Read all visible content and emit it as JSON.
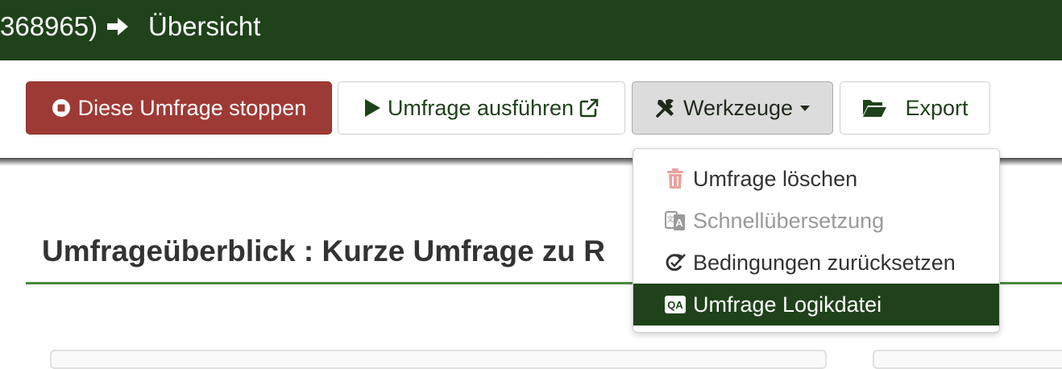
{
  "breadcrumb": {
    "previous": "368965)",
    "current": "Übersicht"
  },
  "toolbar": {
    "stop_label": "Diese Umfrage stoppen",
    "run_label": "Umfrage ausführen",
    "tools_label": "Werkzeuge",
    "export_label": "Export"
  },
  "tools_menu": {
    "items": [
      {
        "label": "Umfrage löschen",
        "icon": "trash-icon",
        "state": "enabled"
      },
      {
        "label": "Schnellübersetzung",
        "icon": "translate-icon",
        "state": "disabled"
      },
      {
        "label": "Bedingungen zurücksetzen",
        "icon": "reset-conditions-icon",
        "state": "enabled"
      },
      {
        "label": "Umfrage Logikdatei",
        "icon": "qa-icon",
        "state": "highlighted"
      }
    ]
  },
  "main": {
    "heading": "Umfrageüberblick : Kurze Umfrage zu R"
  },
  "colors": {
    "brand_dark_green": "#1f421a",
    "stop_red": "#9e3a35",
    "accent_green": "#4a8a3e"
  }
}
